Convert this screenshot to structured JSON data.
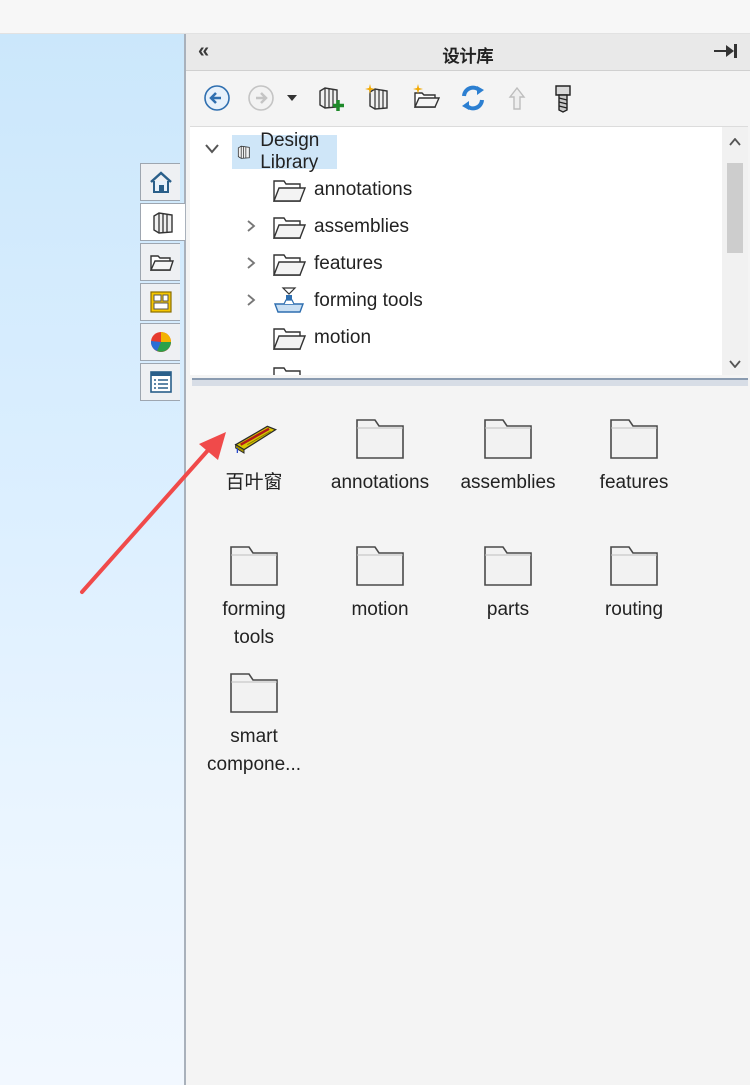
{
  "panel": {
    "title": "设计库",
    "collapse_glyph": "«",
    "pin_icon": "pin-icon"
  },
  "toolbar": {
    "items": [
      "back-icon",
      "forward-icon",
      "dropdown-arrow-icon",
      "add-to-library-icon",
      "add-file-location-icon",
      "create-new-folder-icon",
      "refresh-icon",
      "up-one-level-icon",
      "toolbox-icon"
    ]
  },
  "side_tabs": [
    "home-icon",
    "design-library-icon",
    "file-explorer-icon",
    "view-palette-icon",
    "appearances-icon",
    "custom-properties-icon"
  ],
  "tree": {
    "root": "Design Library",
    "children": [
      {
        "label": "annotations",
        "expandable": false
      },
      {
        "label": "assemblies",
        "expandable": true
      },
      {
        "label": "features",
        "expandable": true
      },
      {
        "label": "forming tools",
        "expandable": true,
        "icon": "forming-tools-icon"
      },
      {
        "label": "motion",
        "expandable": false
      }
    ]
  },
  "thumbnails": [
    {
      "label": "百叶窗",
      "icon": "louver-tool-icon"
    },
    {
      "label": "annotations"
    },
    {
      "label": "assemblies"
    },
    {
      "label": "features"
    },
    {
      "label": "forming tools"
    },
    {
      "label": "motion"
    },
    {
      "label": "parts"
    },
    {
      "label": "routing"
    },
    {
      "label": "smart compone..."
    }
  ],
  "annotation": {
    "arrow_color": "#f04a4a"
  }
}
